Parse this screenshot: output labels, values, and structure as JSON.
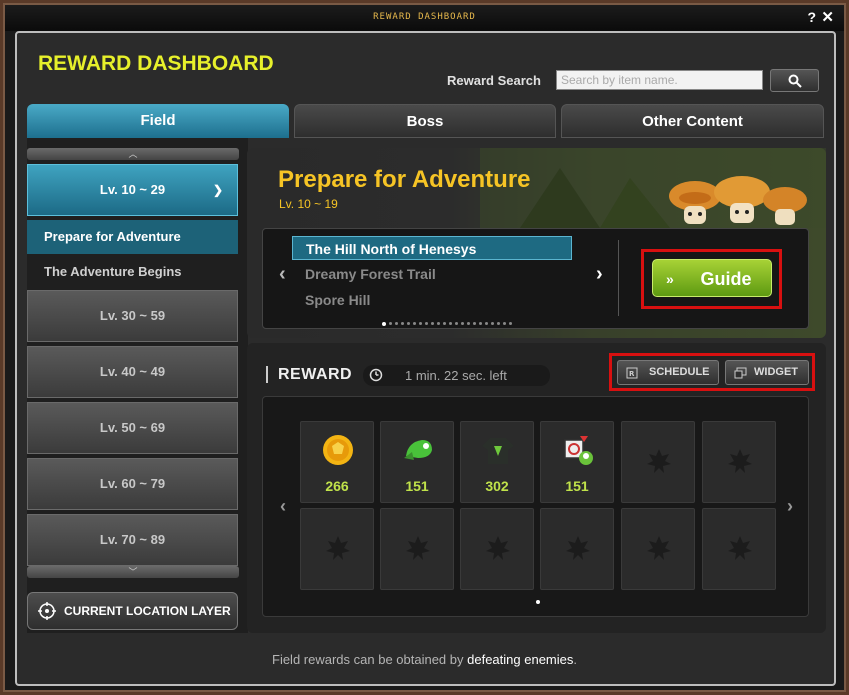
{
  "window_title": "REWARD DASHBOARD",
  "help_label": "?",
  "close_label": "✕",
  "header": {
    "title": "REWARD DASHBOARD"
  },
  "search": {
    "label": "Reward Search",
    "placeholder": "Search by item name."
  },
  "tabs": [
    {
      "label": "Field",
      "active": true
    },
    {
      "label": "Boss",
      "active": false
    },
    {
      "label": "Other Content",
      "active": false
    }
  ],
  "level_groups": [
    {
      "label": "Lv. 10 ~ 29",
      "expanded": true
    },
    {
      "label": "Lv. 30 ~ 59"
    },
    {
      "label": "Lv. 40 ~ 49"
    },
    {
      "label": "Lv. 50 ~ 69"
    },
    {
      "label": "Lv. 60 ~ 79"
    },
    {
      "label": "Lv. 70 ~ 89"
    }
  ],
  "sub_areas": [
    {
      "label": "Prepare for Adventure",
      "active": true
    },
    {
      "label": "The Adventure Begins",
      "active": false
    }
  ],
  "location_button": "CURRENT LOCATION LAYER",
  "area": {
    "title": "Prepare for Adventure",
    "level": "Lv. 10 ~ 19"
  },
  "maps": [
    {
      "label": "The Hill North of Henesys",
      "active": true
    },
    {
      "label": "Dreamy Forest Trail",
      "active": false
    },
    {
      "label": "Spore Hill",
      "active": false
    }
  ],
  "guide_button": "Guide",
  "reward": {
    "title": "REWARD",
    "timer": "1 min. 22 sec. left"
  },
  "buttons": {
    "schedule": "SCHEDULE",
    "widget": "WIDGET"
  },
  "items": [
    {
      "icon": "gold-coin-icon",
      "count": "266"
    },
    {
      "icon": "green-cap-icon",
      "count": "151"
    },
    {
      "icon": "dark-shirt-icon",
      "count": "302"
    },
    {
      "icon": "mushroom-box-icon",
      "count": "151"
    }
  ],
  "footer": {
    "text": "Field rewards can be obtained by ",
    "highlight": "defeating enemies",
    "end": "."
  },
  "colors": {
    "accent": "#1d6f8e",
    "guide_green": "#7cba24",
    "title_yellow": "#f6c425",
    "highlight_red": "#d81010"
  }
}
